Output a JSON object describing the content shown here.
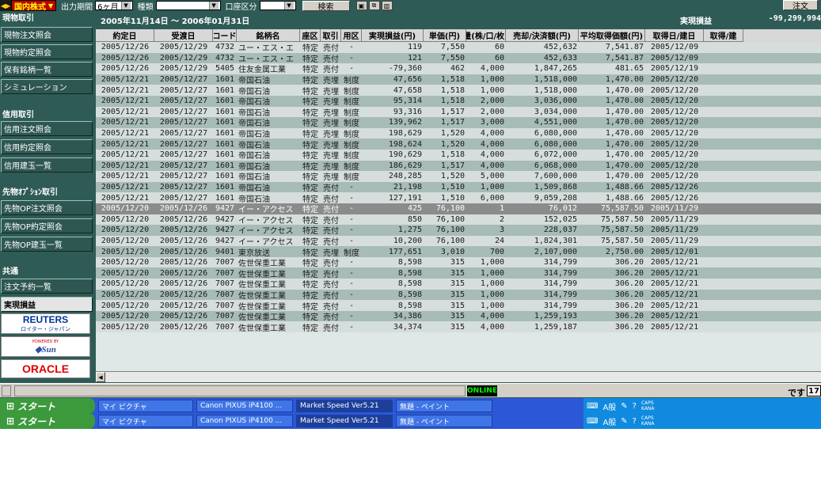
{
  "toolbar": {
    "market": "国内株式",
    "period_label": "出力期間",
    "period_value": "6ヶ月",
    "type_label": "種類",
    "type_value": "",
    "account_label": "口座区分",
    "account_value": "",
    "search_button": "検索",
    "order_button": "注文"
  },
  "summary": {
    "date_range": "2005年11月14日 ～ 2006年01月31日",
    "label": "実現損益",
    "value": "-99,299,994"
  },
  "sidebar": {
    "sections": [
      {
        "label": "現物取引"
      },
      {
        "label": "信用取引"
      },
      {
        "label": "先物ｵﾌﾟｼｮﾝ取引"
      },
      {
        "label": "共通"
      }
    ],
    "items": [
      {
        "label": "現物注文照会"
      },
      {
        "label": "現物約定照会"
      },
      {
        "label": "保有銘柄一覧"
      },
      {
        "label": "シミュレーション"
      },
      {
        "label": "信用注文照会"
      },
      {
        "label": "信用約定照会"
      },
      {
        "label": "信用建玉一覧"
      },
      {
        "label": "先物OP注文照会"
      },
      {
        "label": "先物OP約定照会"
      },
      {
        "label": "先物OP建玉一覧"
      },
      {
        "label": "注文予約一覧"
      },
      {
        "label": "実現損益"
      }
    ],
    "logos": {
      "reuters": "REUTERS",
      "reuters_sub": "ロイター・ジャパン",
      "sun_top": "POWERED BY",
      "sun": "Sun",
      "oracle": "ORACLE"
    }
  },
  "table": {
    "columns": [
      "約定日",
      "受渡日",
      "コード",
      "銘柄名",
      "座区",
      "取引",
      "用区",
      "実現損益(円)",
      "単価(円)",
      "量(株/口/枚)",
      "売却/決済額(円)",
      "平均取得価額(円)",
      "取得日/建日",
      "取得/建"
    ],
    "rows": [
      [
        "2005/12/26",
        "2005/12/29",
        "4732",
        "ユー・エス・エ",
        "特定",
        "売付",
        "-",
        "119",
        "7,550",
        "60",
        "452,632",
        "7,541.87",
        "2005/12/09",
        ""
      ],
      [
        "2005/12/26",
        "2005/12/29",
        "4732",
        "ユー・エス・エ",
        "特定",
        "売付",
        "-",
        "121",
        "7,550",
        "60",
        "452,633",
        "7,541.87",
        "2005/12/09",
        ""
      ],
      [
        "2005/12/26",
        "2005/12/29",
        "5405",
        "住友金属工業",
        "特定",
        "売付",
        "-",
        "-79,360",
        "462",
        "4,000",
        "1,847,265",
        "481.65",
        "2005/12/19",
        ""
      ],
      [
        "2005/12/21",
        "2005/12/27",
        "1601",
        "帝国石油",
        "特定",
        "売埋",
        "制度",
        "47,656",
        "1,518",
        "1,000",
        "1,518,000",
        "1,470.00",
        "2005/12/20",
        ""
      ],
      [
        "2005/12/21",
        "2005/12/27",
        "1601",
        "帝国石油",
        "特定",
        "売埋",
        "制度",
        "47,658",
        "1,518",
        "1,000",
        "1,518,000",
        "1,470.00",
        "2005/12/20",
        ""
      ],
      [
        "2005/12/21",
        "2005/12/27",
        "1601",
        "帝国石油",
        "特定",
        "売埋",
        "制度",
        "95,314",
        "1,518",
        "2,000",
        "3,036,000",
        "1,470.00",
        "2005/12/20",
        ""
      ],
      [
        "2005/12/21",
        "2005/12/27",
        "1601",
        "帝国石油",
        "特定",
        "売埋",
        "制度",
        "93,316",
        "1,517",
        "2,000",
        "3,034,000",
        "1,470.00",
        "2005/12/20",
        ""
      ],
      [
        "2005/12/21",
        "2005/12/27",
        "1601",
        "帝国石油",
        "特定",
        "売埋",
        "制度",
        "139,962",
        "1,517",
        "3,000",
        "4,551,000",
        "1,470.00",
        "2005/12/20",
        ""
      ],
      [
        "2005/12/21",
        "2005/12/27",
        "1601",
        "帝国石油",
        "特定",
        "売埋",
        "制度",
        "198,629",
        "1,520",
        "4,000",
        "6,080,000",
        "1,470.00",
        "2005/12/20",
        ""
      ],
      [
        "2005/12/21",
        "2005/12/27",
        "1601",
        "帝国石油",
        "特定",
        "売埋",
        "制度",
        "198,624",
        "1,520",
        "4,000",
        "6,080,000",
        "1,470.00",
        "2005/12/20",
        ""
      ],
      [
        "2005/12/21",
        "2005/12/27",
        "1601",
        "帝国石油",
        "特定",
        "売埋",
        "制度",
        "190,629",
        "1,518",
        "4,000",
        "6,072,000",
        "1,470.00",
        "2005/12/20",
        ""
      ],
      [
        "2005/12/21",
        "2005/12/27",
        "1601",
        "帝国石油",
        "特定",
        "売埋",
        "制度",
        "186,629",
        "1,517",
        "4,000",
        "6,068,000",
        "1,470.00",
        "2005/12/20",
        ""
      ],
      [
        "2005/12/21",
        "2005/12/27",
        "1601",
        "帝国石油",
        "特定",
        "売埋",
        "制度",
        "248,285",
        "1,520",
        "5,000",
        "7,600,000",
        "1,470.00",
        "2005/12/20",
        ""
      ],
      [
        "2005/12/21",
        "2005/12/27",
        "1601",
        "帝国石油",
        "特定",
        "売付",
        "-",
        "21,198",
        "1,510",
        "1,000",
        "1,509,868",
        "1,488.66",
        "2005/12/26",
        ""
      ],
      [
        "2005/12/21",
        "2005/12/27",
        "1601",
        "帝国石油",
        "特定",
        "売付",
        "-",
        "127,191",
        "1,510",
        "6,000",
        "9,059,208",
        "1,488.66",
        "2005/12/26",
        ""
      ],
      [
        "2005/12/20",
        "2005/12/26",
        "9427",
        "イー・アクセス",
        "特定",
        "売付",
        "-",
        "425",
        "76,100",
        "1",
        "76,012",
        "75,587.50",
        "2005/11/29",
        ""
      ],
      [
        "2005/12/20",
        "2005/12/26",
        "9427",
        "イー・アクセス",
        "特定",
        "売付",
        "-",
        "850",
        "76,100",
        "2",
        "152,025",
        "75,587.50",
        "2005/11/29",
        ""
      ],
      [
        "2005/12/20",
        "2005/12/26",
        "9427",
        "イー・アクセス",
        "特定",
        "売付",
        "-",
        "1,275",
        "76,100",
        "3",
        "228,037",
        "75,587.50",
        "2005/11/29",
        ""
      ],
      [
        "2005/12/20",
        "2005/12/26",
        "9427",
        "イー・アクセス",
        "特定",
        "売付",
        "-",
        "10,200",
        "76,100",
        "24",
        "1,824,301",
        "75,587.50",
        "2005/11/29",
        ""
      ],
      [
        "2005/12/20",
        "2005/12/26",
        "9401",
        "東京放送",
        "特定",
        "売埋",
        "制度",
        "177,651",
        "3,010",
        "700",
        "2,107,000",
        "2,750.00",
        "2005/12/01",
        ""
      ],
      [
        "2005/12/20",
        "2005/12/26",
        "7007",
        "佐世保重工業",
        "特定",
        "売付",
        "-",
        "8,598",
        "315",
        "1,000",
        "314,799",
        "306.20",
        "2005/12/21",
        ""
      ],
      [
        "2005/12/20",
        "2005/12/26",
        "7007",
        "佐世保重工業",
        "特定",
        "売付",
        "-",
        "8,598",
        "315",
        "1,000",
        "314,799",
        "306.20",
        "2005/12/21",
        ""
      ],
      [
        "2005/12/20",
        "2005/12/26",
        "7007",
        "佐世保重工業",
        "特定",
        "売付",
        "-",
        "8,598",
        "315",
        "1,000",
        "314,799",
        "306.20",
        "2005/12/21",
        ""
      ],
      [
        "2005/12/20",
        "2005/12/26",
        "7007",
        "佐世保重工業",
        "特定",
        "売付",
        "-",
        "8,598",
        "315",
        "1,000",
        "314,799",
        "306.20",
        "2005/12/21",
        ""
      ],
      [
        "2005/12/20",
        "2005/12/26",
        "7007",
        "佐世保重工業",
        "特定",
        "売付",
        "-",
        "8,598",
        "315",
        "1,000",
        "314,799",
        "306.20",
        "2005/12/21",
        ""
      ],
      [
        "2005/12/20",
        "2005/12/26",
        "7007",
        "佐世保重工業",
        "特定",
        "売付",
        "-",
        "34,386",
        "315",
        "4,000",
        "1,259,193",
        "306.20",
        "2005/12/21",
        ""
      ],
      [
        "2005/12/20",
        "2005/12/26",
        "7007",
        "佐世保重工業",
        "特定",
        "売付",
        "-",
        "34,374",
        "315",
        "4,000",
        "1,259,187",
        "306.20",
        "2005/12/21",
        ""
      ]
    ],
    "selected_row": 15
  },
  "statusbar": {
    "online": "ONLINE",
    "message": "です",
    "number": "17"
  },
  "taskbar": {
    "start": "スタート",
    "tasks": [
      "マイ ピクチャ",
      "Canon PIXUS iP4100 ...",
      "Market Speed Ver5.21",
      "無題 - ペイント"
    ],
    "tray_text": "A般",
    "caps": "CAPS",
    "kana": "KANA"
  },
  "colors": {
    "app_bg": "#2f5b56",
    "row_light": "#d5dedc",
    "row_dark": "#a7bbb8",
    "selected_row": "#8b8b8b",
    "taskbar": "#2c58d8",
    "start": "#3c9a3c",
    "market_button": "#c00000"
  }
}
